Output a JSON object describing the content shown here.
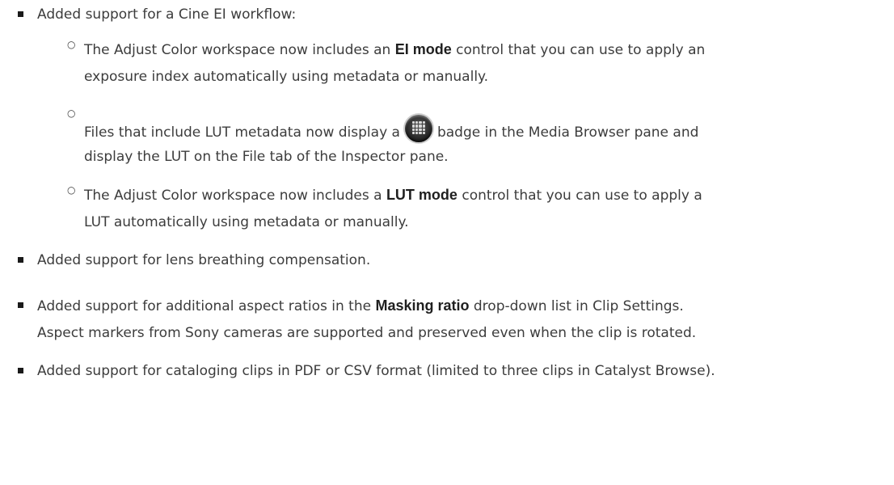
{
  "items": [
    {
      "text": "Added support for a Cine EI workflow:",
      "subitems": [
        {
          "before": "The Adjust Color workspace now includes an ",
          "strong": "EI mode",
          "after": " control that you can use to apply an",
          "line2": "exposure index automatically using metadata or manually."
        },
        {
          "before": "Files that include LUT metadata now display a",
          "badge_icon": "lut-badge-icon",
          "after": "badge in the Media Browser pane and",
          "line2": "display the LUT on the File tab of the Inspector pane."
        },
        {
          "before": "The Adjust Color workspace now includes a ",
          "strong": "LUT mode",
          "after": " control that you can use to apply a",
          "line2": "LUT automatically using metadata or manually."
        }
      ]
    },
    {
      "text": "Added support for lens breathing compensation."
    },
    {
      "before": "Added support for additional aspect ratios in the ",
      "strong": "Masking ratio",
      "after": " drop-down list in Clip Settings.",
      "line2": "Aspect markers from Sony cameras are supported and preserved even when the clip is rotated."
    },
    {
      "text": "Added support for cataloging clips in PDF or CSV format (limited to three clips in Catalyst Browse)."
    }
  ]
}
